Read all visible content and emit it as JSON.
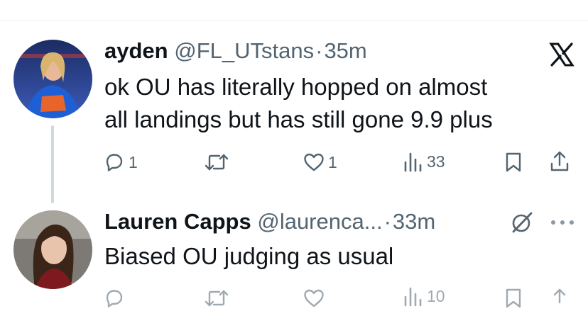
{
  "tweet1": {
    "name": "ayden",
    "handle": "@FL_UTstans",
    "separator": "·",
    "time": "35m",
    "text_line1": "ok OU has literally hopped on almost",
    "text_line2": "all landings but has still gone 9.9 plus",
    "replies": "1",
    "likes": "1",
    "views": "33"
  },
  "tweet2": {
    "name": "Lauren Capps",
    "handle": "@laurenca...",
    "separator": "·",
    "time": "33m",
    "text": "Biased OU judging as usual",
    "views": "10"
  },
  "icons": {
    "close": "x-logo-icon",
    "grok": "grok-icon",
    "more": "more-icon",
    "reply": "reply-icon",
    "retweet": "retweet-icon",
    "like": "heart-icon",
    "views": "views-icon",
    "bookmark": "bookmark-icon",
    "share": "share-icon"
  },
  "colors": {
    "text": "#0f1419",
    "secondary": "#536471",
    "divider": "#eff3f4",
    "thread_line": "#cfd9de"
  }
}
